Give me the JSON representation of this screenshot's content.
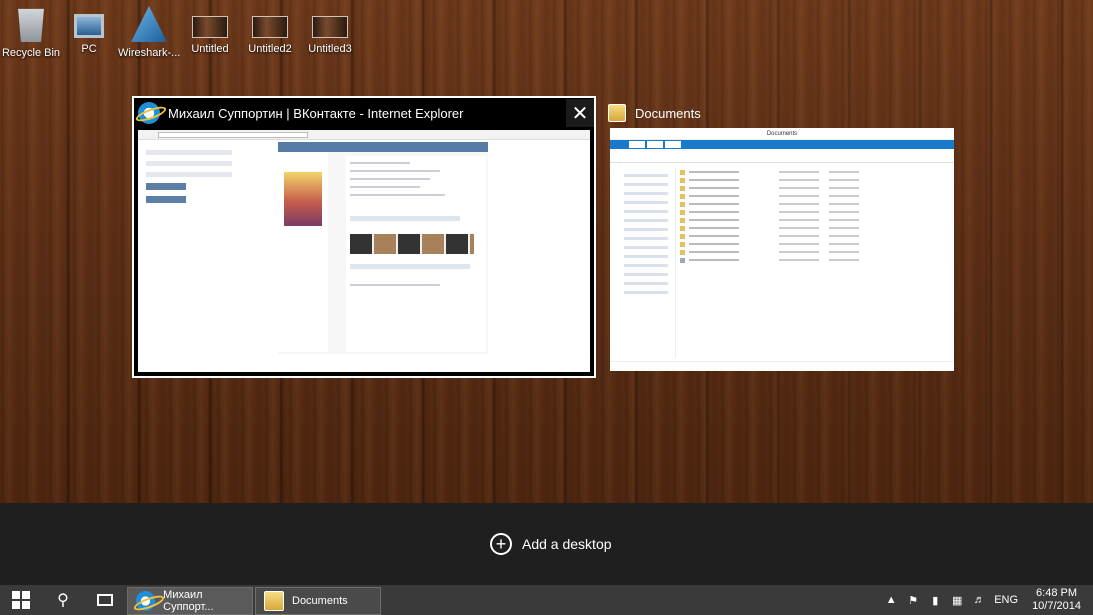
{
  "desktop": {
    "icons": [
      {
        "label": "Recycle Bin",
        "icon": "recycle-bin-icon"
      },
      {
        "label": "PC",
        "icon": "computer-icon"
      },
      {
        "label": "Wireshark-...",
        "icon": "wireshark-icon"
      },
      {
        "label": "Untitled",
        "icon": "image-thumbnail-icon"
      },
      {
        "label": "Untitled2",
        "icon": "image-thumbnail-icon"
      },
      {
        "label": "Untitled3",
        "icon": "image-thumbnail-icon"
      }
    ]
  },
  "task_view": {
    "windows": [
      {
        "title": "Михаил Суппортин | ВКонтакте - Internet Explorer",
        "icon": "internet-explorer-icon",
        "close": "✕"
      },
      {
        "title": "Documents",
        "icon": "folder-icon"
      }
    ],
    "add_desktop": "Add a desktop"
  },
  "taskbar": {
    "apps": [
      {
        "label": "Михаил Суппорт...",
        "icon": "internet-explorer-icon"
      },
      {
        "label": "Documents",
        "icon": "folder-icon"
      }
    ],
    "tray": {
      "lang": "ENG",
      "time": "6:48 PM",
      "date": "10/7/2014"
    }
  },
  "colors": {
    "accent": "#1979ca",
    "taskbar": "#3a3a3a",
    "task_view_bar": "#1f1f1f"
  }
}
